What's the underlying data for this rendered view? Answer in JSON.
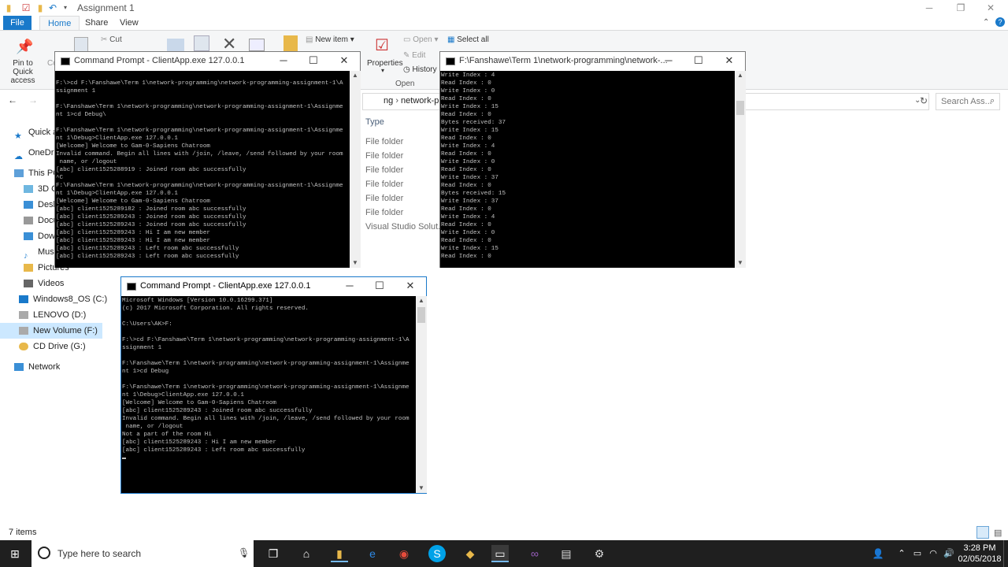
{
  "explorer": {
    "title": "Assignment 1",
    "tabs": [
      "File",
      "Home",
      "Share",
      "View"
    ],
    "ribbon": {
      "pin_label_1": "Pin to Quick",
      "pin_label_2": "access",
      "copy_label": "Co",
      "cut_label": "Cut",
      "new_item_label": "New item",
      "properties_label": "Properties",
      "open_label": "Open",
      "edit_label": "Edit",
      "history_label": "History",
      "open_group_label": "Open",
      "select_all_label": "Select all"
    },
    "address": {
      "path_part_1": "ng",
      "path_part_2": "network-program",
      "search_placeholder": "Search Ass..."
    },
    "nav": {
      "quick_access": "Quick a",
      "onedrive": "OneDri",
      "this_pc": "This PC",
      "objects_3d": "3D Ob",
      "desktop": "Deskt",
      "documents": "Docur",
      "downloads": "Down",
      "music": "Music",
      "pictures": "Pictures",
      "videos": "Videos",
      "windows_os": "Windows8_OS (C:)",
      "lenovo": "LENOVO (D:)",
      "new_volume": "New Volume (F:)",
      "cd_drive": "CD Drive (G:)",
      "network": "Network"
    },
    "type_column": {
      "header": "Type",
      "rows": [
        "File folder",
        "File folder",
        "File folder",
        "File folder",
        "File folder",
        "File folder",
        "Visual Studio Solut..."
      ]
    },
    "status": "7 items"
  },
  "win1": {
    "title": "Command Prompt - ClientApp.exe  127.0.0.1",
    "lines": [
      "",
      "F:\\>cd F:\\Fanshawe\\Term 1\\network-programming\\network-programming-assignment-1\\A",
      "ssignment 1",
      "",
      "F:\\Fanshawe\\Term 1\\network-programming\\network-programming-assignment-1\\Assignme",
      "nt 1>cd Debug\\",
      "",
      "F:\\Fanshawe\\Term 1\\network-programming\\network-programming-assignment-1\\Assignme",
      "nt 1\\Debug>ClientApp.exe 127.0.0.1",
      "[Welcome] Welcome to Gam-0-Sapiens Chatroom",
      "Invalid command. Begin all lines with /join, /leave, /send followed by your room",
      " name, or /logout",
      "[abc] client1525288919 : Joined room abc successfully",
      "^C",
      "F:\\Fanshawe\\Term 1\\network-programming\\network-programming-assignment-1\\Assignme",
      "nt 1\\Debug>ClientApp.exe 127.0.0.1",
      "[Welcome] Welcome to Gam-0-Sapiens Chatroom",
      "[abc] client1525289182 : Joined room abc successfully",
      "[abc] client1525289243 : Joined room abc successfully",
      "[abc] client1525289243 : Joined room abc successfully",
      "[abc] client1525289243 : Hi I am new member",
      "[abc] client1525289243 : Hi I am new member",
      "[abc] client1525289243 : Left room abc successfully",
      "[abc] client1525289243 : Left room abc successfully"
    ]
  },
  "win2": {
    "title": "F:\\Fanshawe\\Term 1\\network-programming\\network-...",
    "lines": [
      "Write Index : 4",
      "Read Index : 0",
      "Write Index : 0",
      "Read Index : 0",
      "Write Index : 15",
      "Read Index : 0",
      "Bytes received: 37",
      "Write Index : 15",
      "Read Index : 0",
      "Write Index : 4",
      "Read Index : 0",
      "Write Index : 0",
      "Read Index : 0",
      "Write Index : 37",
      "Read Index : 0",
      "Bytes received: 15",
      "Write Index : 37",
      "Read Index : 0",
      "Write Index : 4",
      "Read Index : 0",
      "Write Index : 0",
      "Read Index : 0",
      "Write Index : 15",
      "Read Index : 0"
    ]
  },
  "win3": {
    "title": "Command Prompt - ClientApp.exe  127.0.0.1",
    "lines": [
      "Microsoft Windows [Version 10.0.16299.371]",
      "(c) 2017 Microsoft Corporation. All rights reserved.",
      "",
      "C:\\Users\\AK>F:",
      "",
      "F:\\>cd F:\\Fanshawe\\Term 1\\network-programming\\network-programming-assignment-1\\A",
      "ssignment 1",
      "",
      "F:\\Fanshawe\\Term 1\\network-programming\\network-programming-assignment-1\\Assignme",
      "nt 1>cd Debug",
      "",
      "F:\\Fanshawe\\Term 1\\network-programming\\network-programming-assignment-1\\Assignme",
      "nt 1\\Debug>ClientApp.exe 127.0.0.1",
      "[Welcome] Welcome to Gam-0-Sapiens Chatroom",
      "[abc] client1525289243 : Joined room abc successfully",
      "Invalid command. Begin all lines with /join, /leave, /send followed by your room",
      " name, or /logout",
      "Not a part of the room Hi",
      "[abc] client1525289243 : Hi I am new member",
      "[abc] client1525289243 : Left room abc successfully"
    ]
  },
  "taskbar": {
    "search_text": "Type here to search",
    "time": "3:28 PM",
    "date": "02/05/2018"
  }
}
